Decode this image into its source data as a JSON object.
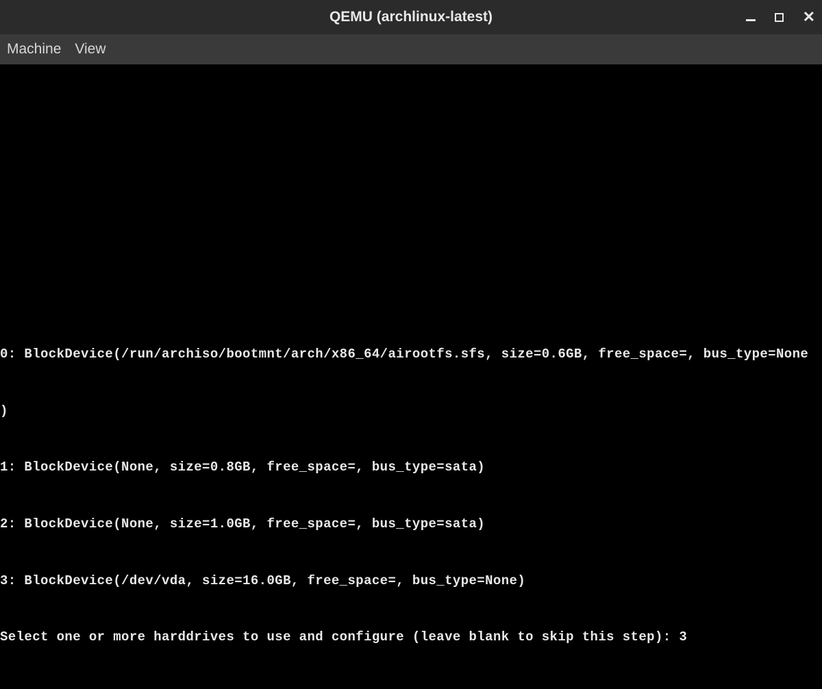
{
  "titlebar": {
    "title": "QEMU (archlinux-latest)"
  },
  "menubar": {
    "items": [
      "Machine",
      "View"
    ]
  },
  "terminal": {
    "lines": [
      "0: BlockDevice(/run/archiso/bootmnt/arch/x86_64/airootfs.sfs, size=0.6GB, free_space=, bus_type=None",
      ")",
      "1: BlockDevice(None, size=0.8GB, free_space=, bus_type=sata)",
      "2: BlockDevice(None, size=1.0GB, free_space=, bus_type=sata)",
      "3: BlockDevice(/dev/vda, size=16.0GB, free_space=, bus_type=None)"
    ],
    "prompt": "Select one or more harddrives to use and configure (leave blank to skip this step): ",
    "input_value": "3"
  }
}
